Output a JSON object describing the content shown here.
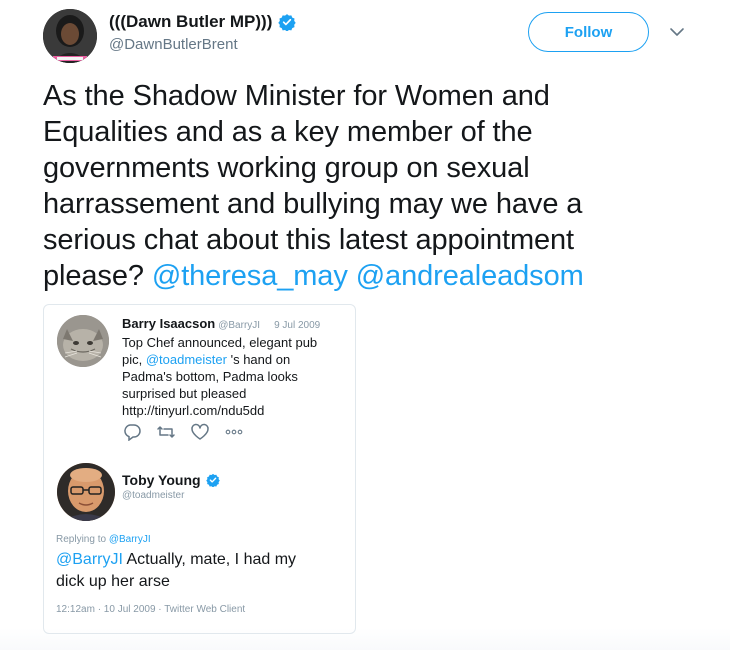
{
  "author": {
    "display_name": "(((Dawn Butler MP)))",
    "handle": "@DawnButlerBrent",
    "verified": true
  },
  "header": {
    "follow_label": "Follow",
    "caret_icon": "chevron-down-icon"
  },
  "tweet": {
    "lines": [
      "As the Shadow Minister for Women and",
      "Equalities and as a key member of the",
      "governments working group on sexual",
      "harrassement and bullying may we have a",
      "serious chat about this latest appointment"
    ],
    "last_line_prefix": "please?",
    "mentions": [
      "@theresa_may",
      "@andrealeadsom"
    ]
  },
  "embedded_image": {
    "tweet1": {
      "name": "Barry Isaacson",
      "handle": "@BarryJI",
      "date": "9 Jul 2009",
      "text_lines": [
        "Top Chef announced, elegant pub",
        "pic,",
        "Padma's bottom, Padma looks",
        "surprised but pleased",
        "http://tinyurl.com/ndu5dd"
      ],
      "inline_mention": "@toadmeister",
      "line2_suffix": " 's hand  on",
      "actions": [
        "reply-icon",
        "retweet-icon",
        "like-icon",
        "more-icon"
      ]
    },
    "tweet2": {
      "name": "Toby Young",
      "handle": "@toadmeister",
      "replying_prefix": "Replying to",
      "replying_to": "@BarryJI",
      "reply_mention": "@BarryJI",
      "text_line1_suffix": " Actually, mate, I had my",
      "text_line2": "dick up her arse",
      "meta": "12:12am · 10 Jul 2009 · Twitter Web Client"
    }
  },
  "colors": {
    "accent": "#1da1f2",
    "text": "#14171a",
    "muted": "#657786"
  }
}
